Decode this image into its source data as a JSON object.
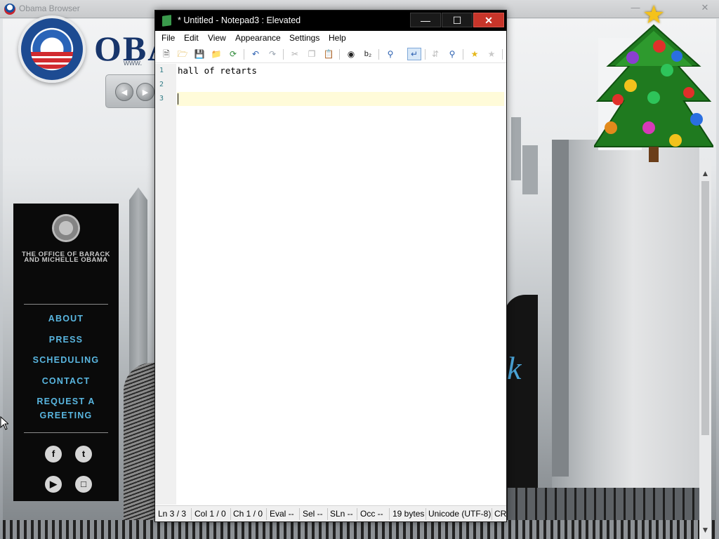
{
  "browser": {
    "title": "Obama Browser",
    "brand_text": "OBA",
    "brand_url": "www."
  },
  "office_panel": {
    "title": "THE OFFICE OF BARACK AND MICHELLE OBAMA",
    "links": [
      "ABOUT",
      "PRESS",
      "SCHEDULING",
      "CONTACT",
      "REQUEST A GREETING"
    ],
    "social_icons": [
      "facebook-icon",
      "twitter-icon",
      "youtube-icon",
      "instagram-icon"
    ]
  },
  "photo_script_text": "k",
  "notepad": {
    "title": "* Untitled - Notepad3 : Elevated",
    "menu": [
      "File",
      "Edit",
      "View",
      "Appearance",
      "Settings",
      "Help"
    ],
    "toolbar_icons": [
      "new-file-icon",
      "open-folder-icon",
      "save-icon",
      "save-as-icon",
      "revert-icon",
      "undo-icon",
      "redo-icon",
      "cut-icon",
      "copy-icon",
      "paste-icon",
      "find-icon",
      "replace-icon",
      "zoom-icon",
      "word-wrap-icon",
      "goto-icon",
      "search-zoom-icon",
      "favorites-icon",
      "add-favorite-icon"
    ],
    "line_numbers": [
      "1",
      "2",
      "3"
    ],
    "lines": [
      "hall of retarts",
      "",
      ""
    ],
    "status": {
      "ln": "Ln  3 / 3",
      "col": "Col  1 / 0",
      "ch": "Ch  1 / 0",
      "eval": "Eval  --",
      "sel": "Sel  --",
      "sln": "SLn  --",
      "occ": "Occ  --",
      "size": "19 bytes",
      "encoding": "Unicode (UTF-8)",
      "eol": "CR"
    }
  },
  "colors": {
    "office_link": "#59b6e0",
    "current_line": "#fffbd9",
    "close_button": "#c7352a"
  }
}
